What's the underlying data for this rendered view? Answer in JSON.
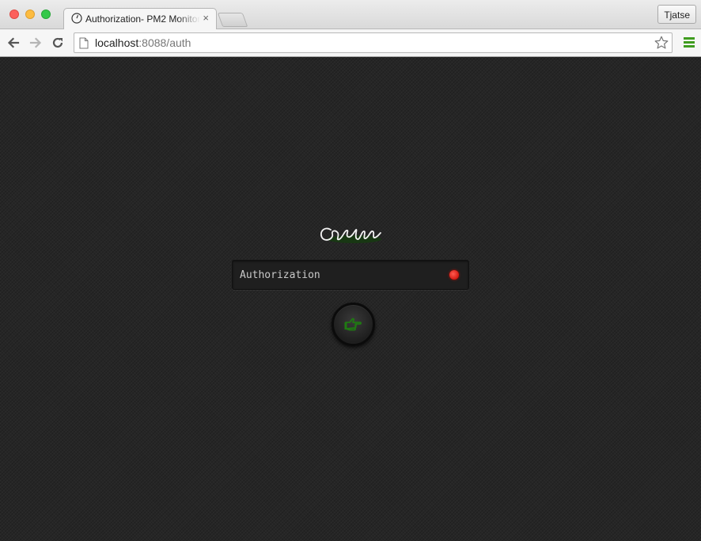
{
  "browser": {
    "tab": {
      "title": "Authorization- PM2 Monitor",
      "close_glyph": "×",
      "favicon": "gauge-icon"
    },
    "profile_button": "Tjatse",
    "address_bar": {
      "host": "localhost",
      "rest": ":8088/auth"
    },
    "icons": {
      "back": "arrow-left-icon",
      "forward": "arrow-right-icon",
      "reload": "reload-icon",
      "page": "page-icon",
      "bookmark": "star-icon",
      "menu": "hamburger-menu-icon"
    }
  },
  "page": {
    "logo": "signature-logo",
    "auth_field": {
      "placeholder": "Authorization",
      "status_color": "#e3231a"
    },
    "submit_icon": "pointing-hand-icon",
    "accent_color": "#1f7a12"
  }
}
